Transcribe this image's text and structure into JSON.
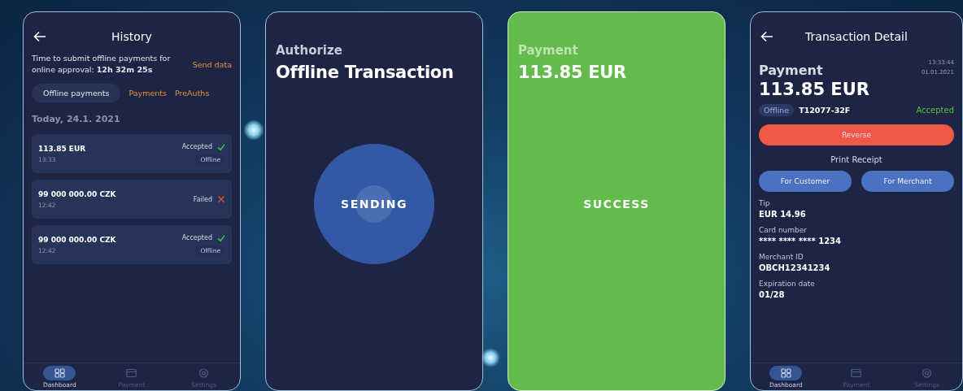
{
  "screens": [
    {
      "kind": "history",
      "title": "History",
      "notice": "Time to submit offline payments for online approval: **12h 32m 25s**",
      "action": "Send data",
      "tabs": [
        {
          "label": "Offline payments",
          "selected": true
        },
        {
          "label": "Payments",
          "selected": false
        },
        {
          "label": "PreAuths",
          "selected": false
        }
      ],
      "date": "Today, 24.1. 2021",
      "transactions": [
        {
          "amount": "113.85 EUR",
          "time": "13:33",
          "status": "Accepted",
          "accepted": true,
          "badge": "Offline"
        },
        {
          "amount": "99 000 000.00 CZK",
          "time": "12:42",
          "status": "Failed",
          "accepted": false
        },
        {
          "amount": "99 000 000.00 CZK",
          "time": "12:42",
          "status": "Accepted",
          "accepted": true,
          "badge": "Offline"
        }
      ],
      "nav": [
        {
          "label": "Dashboard",
          "selected": true
        },
        {
          "label": "Payment",
          "selected": false
        },
        {
          "label": "Settings",
          "selected": false
        }
      ]
    },
    {
      "kind": "authorize",
      "label": "Authorize",
      "title": "Offline Transaction",
      "button": "SENDING"
    },
    {
      "kind": "success",
      "label": "Payment",
      "amount": "113.85 EUR",
      "status": "SUCCESS"
    },
    {
      "kind": "detail",
      "title": "Transaction Detail",
      "label": "Payment",
      "time": "13:33:44",
      "date": "01.01.2021",
      "amount": "113.85 EUR",
      "badge": "Offline",
      "id": "T12077-32F",
      "status": "Accepted",
      "reverse": "Reverse",
      "print_label": "Print Receipt",
      "print_buttons": [
        "For Customer",
        "For Merchant"
      ],
      "fields": [
        {
          "label": "Tip",
          "value": "EUR 14.96"
        },
        {
          "label": "Card number",
          "value": "**** **** **** 1234"
        },
        {
          "label": "Merchant ID",
          "value": "OBCH12341234"
        },
        {
          "label": "Expiration date",
          "value": "01/28"
        }
      ],
      "nav": [
        {
          "label": "Dashboard",
          "selected": true
        },
        {
          "label": "Payment",
          "selected": false
        },
        {
          "label": "Settings",
          "selected": false
        }
      ]
    }
  ]
}
